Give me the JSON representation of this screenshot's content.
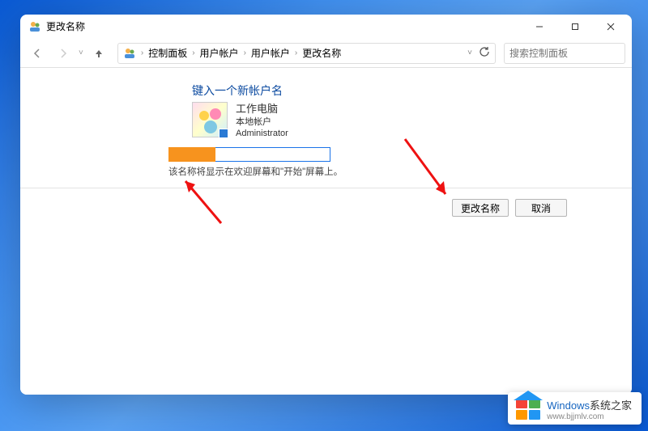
{
  "window": {
    "title": "更改名称"
  },
  "nav": {
    "breadcrumb": {
      "items": [
        "控制面板",
        "用户帐户",
        "用户帐户",
        "更改名称"
      ]
    },
    "search_placeholder": "搜索控制面板"
  },
  "page": {
    "heading": "键入一个新帐户名",
    "account": {
      "name": "工作电脑",
      "type": "本地帐户",
      "role": "Administrator"
    },
    "input_value": "",
    "helper_text": "该名称将显示在欢迎屏幕和\"开始\"屏幕上。",
    "actions": {
      "primary": "更改名称",
      "secondary": "取消"
    }
  },
  "watermark": {
    "brand_en": "Windows",
    "brand_cn": "系统之家",
    "url": "www.bjjmlv.com"
  }
}
